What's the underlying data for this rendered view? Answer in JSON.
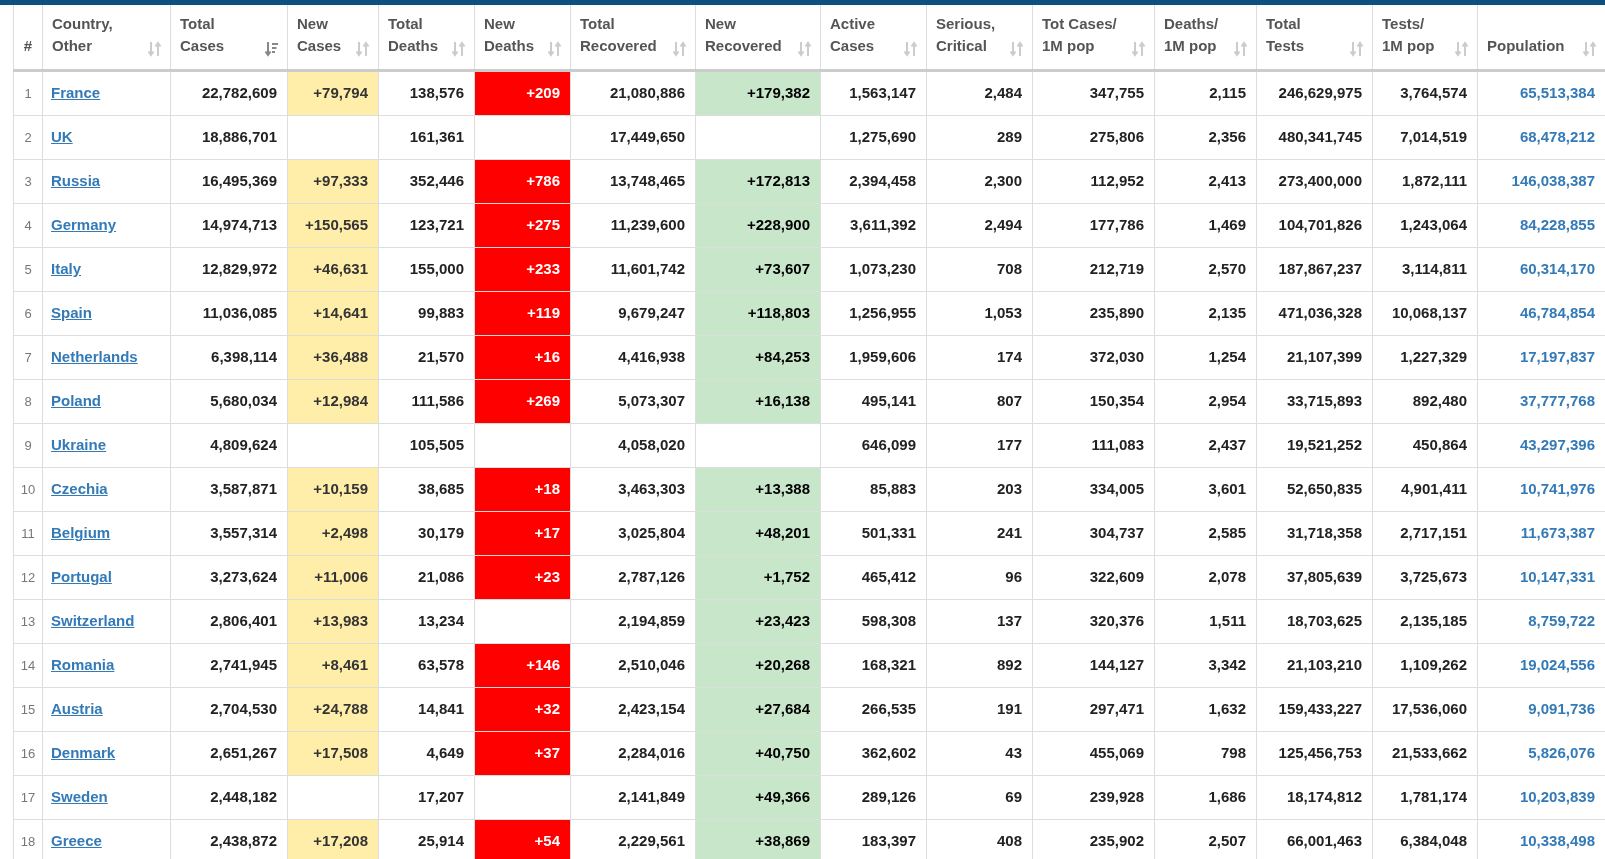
{
  "table": {
    "columns": [
      {
        "label": "#"
      },
      {
        "label": "Country,\nOther",
        "sorted": false
      },
      {
        "label": "Total\nCases",
        "sorted": true
      },
      {
        "label": "New\nCases",
        "sorted": false
      },
      {
        "label": "Total\nDeaths",
        "sorted": false
      },
      {
        "label": "New\nDeaths",
        "sorted": false
      },
      {
        "label": "Total\nRecovered",
        "sorted": false
      },
      {
        "label": "New\nRecovered",
        "sorted": false
      },
      {
        "label": "Active\nCases",
        "sorted": false
      },
      {
        "label": "Serious,\nCritical",
        "sorted": false
      },
      {
        "label": "Tot Cases/\n1M pop",
        "sorted": false
      },
      {
        "label": "Deaths/\n1M pop",
        "sorted": false
      },
      {
        "label": "Total\nTests",
        "sorted": false
      },
      {
        "label": "Tests/\n1M pop",
        "sorted": false
      },
      {
        "label": "Population",
        "sorted": false
      }
    ],
    "rows": [
      {
        "rank": "1",
        "country": "France",
        "total_cases": "22,782,609",
        "new_cases": "+79,794",
        "total_deaths": "138,576",
        "new_deaths": "+209",
        "total_recovered": "21,080,886",
        "new_recovered": "+179,382",
        "active_cases": "1,563,147",
        "serious_critical": "2,484",
        "cases_per_1m": "347,755",
        "deaths_per_1m": "2,115",
        "total_tests": "246,629,975",
        "tests_per_1m": "3,764,574",
        "population": "65,513,384"
      },
      {
        "rank": "2",
        "country": "UK",
        "total_cases": "18,886,701",
        "total_deaths": "161,361",
        "total_recovered": "17,449,650",
        "active_cases": "1,275,690",
        "serious_critical": "289",
        "cases_per_1m": "275,806",
        "deaths_per_1m": "2,356",
        "total_tests": "480,341,745",
        "tests_per_1m": "7,014,519",
        "population": "68,478,212"
      },
      {
        "rank": "3",
        "country": "Russia",
        "total_cases": "16,495,369",
        "new_cases": "+97,333",
        "total_deaths": "352,446",
        "new_deaths": "+786",
        "total_recovered": "13,748,465",
        "new_recovered": "+172,813",
        "active_cases": "2,394,458",
        "serious_critical": "2,300",
        "cases_per_1m": "112,952",
        "deaths_per_1m": "2,413",
        "total_tests": "273,400,000",
        "tests_per_1m": "1,872,111",
        "population": "146,038,387"
      },
      {
        "rank": "4",
        "country": "Germany",
        "total_cases": "14,974,713",
        "new_cases": "+150,565",
        "total_deaths": "123,721",
        "new_deaths": "+275",
        "total_recovered": "11,239,600",
        "new_recovered": "+228,900",
        "active_cases": "3,611,392",
        "serious_critical": "2,494",
        "cases_per_1m": "177,786",
        "deaths_per_1m": "1,469",
        "total_tests": "104,701,826",
        "tests_per_1m": "1,243,064",
        "population": "84,228,855"
      },
      {
        "rank": "5",
        "country": "Italy",
        "total_cases": "12,829,972",
        "new_cases": "+46,631",
        "total_deaths": "155,000",
        "new_deaths": "+233",
        "total_recovered": "11,601,742",
        "new_recovered": "+73,607",
        "active_cases": "1,073,230",
        "serious_critical": "708",
        "cases_per_1m": "212,719",
        "deaths_per_1m": "2,570",
        "total_tests": "187,867,237",
        "tests_per_1m": "3,114,811",
        "population": "60,314,170"
      },
      {
        "rank": "6",
        "country": "Spain",
        "total_cases": "11,036,085",
        "new_cases": "+14,641",
        "total_deaths": "99,883",
        "new_deaths": "+119",
        "total_recovered": "9,679,247",
        "new_recovered": "+118,803",
        "active_cases": "1,256,955",
        "serious_critical": "1,053",
        "cases_per_1m": "235,890",
        "deaths_per_1m": "2,135",
        "total_tests": "471,036,328",
        "tests_per_1m": "10,068,137",
        "population": "46,784,854"
      },
      {
        "rank": "7",
        "country": "Netherlands",
        "total_cases": "6,398,114",
        "new_cases": "+36,488",
        "total_deaths": "21,570",
        "new_deaths": "+16",
        "total_recovered": "4,416,938",
        "new_recovered": "+84,253",
        "active_cases": "1,959,606",
        "serious_critical": "174",
        "cases_per_1m": "372,030",
        "deaths_per_1m": "1,254",
        "total_tests": "21,107,399",
        "tests_per_1m": "1,227,329",
        "population": "17,197,837"
      },
      {
        "rank": "8",
        "country": "Poland",
        "total_cases": "5,680,034",
        "new_cases": "+12,984",
        "total_deaths": "111,586",
        "new_deaths": "+269",
        "total_recovered": "5,073,307",
        "new_recovered": "+16,138",
        "active_cases": "495,141",
        "serious_critical": "807",
        "cases_per_1m": "150,354",
        "deaths_per_1m": "2,954",
        "total_tests": "33,715,893",
        "tests_per_1m": "892,480",
        "population": "37,777,768"
      },
      {
        "rank": "9",
        "country": "Ukraine",
        "total_cases": "4,809,624",
        "total_deaths": "105,505",
        "total_recovered": "4,058,020",
        "active_cases": "646,099",
        "serious_critical": "177",
        "cases_per_1m": "111,083",
        "deaths_per_1m": "2,437",
        "total_tests": "19,521,252",
        "tests_per_1m": "450,864",
        "population": "43,297,396"
      },
      {
        "rank": "10",
        "country": "Czechia",
        "total_cases": "3,587,871",
        "new_cases": "+10,159",
        "total_deaths": "38,685",
        "new_deaths": "+18",
        "total_recovered": "3,463,303",
        "new_recovered": "+13,388",
        "active_cases": "85,883",
        "serious_critical": "203",
        "cases_per_1m": "334,005",
        "deaths_per_1m": "3,601",
        "total_tests": "52,650,835",
        "tests_per_1m": "4,901,411",
        "population": "10,741,976"
      },
      {
        "rank": "11",
        "country": "Belgium",
        "total_cases": "3,557,314",
        "new_cases": "+2,498",
        "total_deaths": "30,179",
        "new_deaths": "+17",
        "total_recovered": "3,025,804",
        "new_recovered": "+48,201",
        "active_cases": "501,331",
        "serious_critical": "241",
        "cases_per_1m": "304,737",
        "deaths_per_1m": "2,585",
        "total_tests": "31,718,358",
        "tests_per_1m": "2,717,151",
        "population": "11,673,387"
      },
      {
        "rank": "12",
        "country": "Portugal",
        "total_cases": "3,273,624",
        "new_cases": "+11,006",
        "total_deaths": "21,086",
        "new_deaths": "+23",
        "total_recovered": "2,787,126",
        "new_recovered": "+1,752",
        "active_cases": "465,412",
        "serious_critical": "96",
        "cases_per_1m": "322,609",
        "deaths_per_1m": "2,078",
        "total_tests": "37,805,639",
        "tests_per_1m": "3,725,673",
        "population": "10,147,331"
      },
      {
        "rank": "13",
        "country": "Switzerland",
        "total_cases": "2,806,401",
        "new_cases": "+13,983",
        "total_deaths": "13,234",
        "total_recovered": "2,194,859",
        "new_recovered": "+23,423",
        "active_cases": "598,308",
        "serious_critical": "137",
        "cases_per_1m": "320,376",
        "deaths_per_1m": "1,511",
        "total_tests": "18,703,625",
        "tests_per_1m": "2,135,185",
        "population": "8,759,722"
      },
      {
        "rank": "14",
        "country": "Romania",
        "total_cases": "2,741,945",
        "new_cases": "+8,461",
        "total_deaths": "63,578",
        "new_deaths": "+146",
        "total_recovered": "2,510,046",
        "new_recovered": "+20,268",
        "active_cases": "168,321",
        "serious_critical": "892",
        "cases_per_1m": "144,127",
        "deaths_per_1m": "3,342",
        "total_tests": "21,103,210",
        "tests_per_1m": "1,109,262",
        "population": "19,024,556"
      },
      {
        "rank": "15",
        "country": "Austria",
        "total_cases": "2,704,530",
        "new_cases": "+24,788",
        "total_deaths": "14,841",
        "new_deaths": "+32",
        "total_recovered": "2,423,154",
        "new_recovered": "+27,684",
        "active_cases": "266,535",
        "serious_critical": "191",
        "cases_per_1m": "297,471",
        "deaths_per_1m": "1,632",
        "total_tests": "159,433,227",
        "tests_per_1m": "17,536,060",
        "population": "9,091,736"
      },
      {
        "rank": "16",
        "country": "Denmark",
        "total_cases": "2,651,267",
        "new_cases": "+17,508",
        "total_deaths": "4,649",
        "new_deaths": "+37",
        "total_recovered": "2,284,016",
        "new_recovered": "+40,750",
        "active_cases": "362,602",
        "serious_critical": "43",
        "cases_per_1m": "455,069",
        "deaths_per_1m": "798",
        "total_tests": "125,456,753",
        "tests_per_1m": "21,533,662",
        "population": "5,826,076"
      },
      {
        "rank": "17",
        "country": "Sweden",
        "total_cases": "2,448,182",
        "total_deaths": "17,207",
        "total_recovered": "2,141,849",
        "new_recovered": "+49,366",
        "active_cases": "289,126",
        "serious_critical": "69",
        "cases_per_1m": "239,928",
        "deaths_per_1m": "1,686",
        "total_tests": "18,174,812",
        "tests_per_1m": "1,781,174",
        "population": "10,203,839"
      },
      {
        "rank": "18",
        "country": "Greece",
        "total_cases": "2,438,872",
        "new_cases": "+17,208",
        "total_deaths": "25,914",
        "new_deaths": "+54",
        "total_recovered": "2,229,561",
        "new_recovered": "+38,869",
        "active_cases": "183,397",
        "serious_critical": "408",
        "cases_per_1m": "235,902",
        "deaths_per_1m": "2,507",
        "total_tests": "66,001,463",
        "tests_per_1m": "6,384,048",
        "population": "10,338,498"
      }
    ]
  }
}
